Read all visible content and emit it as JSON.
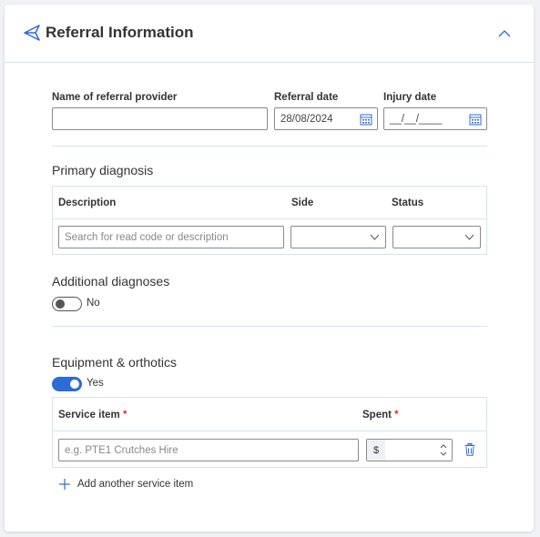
{
  "header": {
    "title": "Referral Information"
  },
  "referral": {
    "provider_label": "Name of referral provider",
    "provider_value": "",
    "referral_date_label": "Referral date",
    "referral_date_value": "28/08/2024",
    "injury_date_label": "Injury date",
    "injury_date_value": "__/__/____"
  },
  "primary_diagnosis": {
    "title": "Primary diagnosis",
    "columns": {
      "description": "Description",
      "side": "Side",
      "status": "Status"
    },
    "search_placeholder": "Search for read code or description",
    "side_value": "",
    "status_value": ""
  },
  "additional_diagnoses": {
    "title": "Additional diagnoses",
    "toggle_label": "No"
  },
  "equipment": {
    "title": "Equipment & orthotics",
    "toggle_label": "Yes",
    "columns": {
      "service_item": "Service item",
      "spent": "Spent",
      "required_mark": "*"
    },
    "service_placeholder": "e.g. PTE1 Crutches Hire",
    "currency_symbol": "$",
    "spent_value": "",
    "add_label": "Add another service item"
  },
  "colors": {
    "accent": "#2d6bd6",
    "border": "#d4e4ee",
    "required": "#dd3333"
  },
  "icons": [
    "send-icon",
    "chevron-up-icon",
    "calendar-icon",
    "chevron-down-icon",
    "trash-icon",
    "plus-icon",
    "spinner-arrows-icon"
  ]
}
